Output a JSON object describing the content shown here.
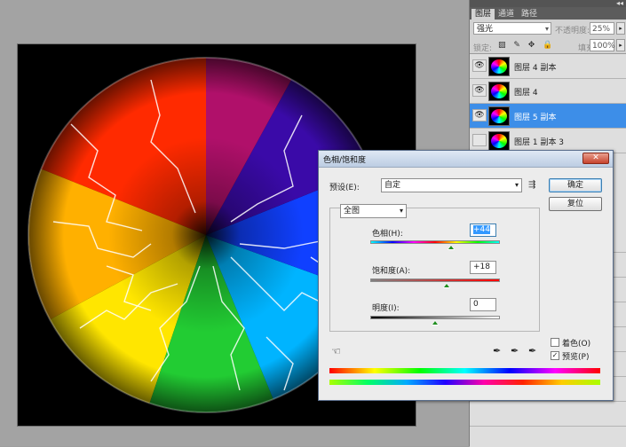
{
  "layers_panel": {
    "tabs": [
      "图层",
      "通道",
      "路径"
    ],
    "blend_mode": "强光",
    "opacity_label": "不透明度:",
    "opacity_value": "25%",
    "lock_label": "锁定:",
    "lock_icons": "▨ ✎ ✥ 🔒",
    "fill_label": "填充:",
    "fill_value": "100%",
    "layers": [
      {
        "name": "图层 4 副本",
        "visible": true,
        "selected": false
      },
      {
        "name": "图层 4",
        "visible": true,
        "selected": false
      },
      {
        "name": "图层 5 副本",
        "visible": true,
        "selected": true
      },
      {
        "name": "图层 1 副本 3",
        "visible": false,
        "selected": false
      }
    ],
    "eye_glyph": "👁"
  },
  "dialog": {
    "title": "色相/饱和度",
    "close_glyph": "✕",
    "preset_label": "预设(E):",
    "preset_value": "自定",
    "preset_menu_glyph": "⇶",
    "ok_label": "确定",
    "reset_label": "复位",
    "channel_value": "全图",
    "sliders": {
      "hue": {
        "label": "色相(H):",
        "value": "+44",
        "level": 44,
        "min": -180,
        "max": 180
      },
      "saturation": {
        "label": "饱和度(A):",
        "value": "+18",
        "level": 18,
        "min": -100,
        "max": 100
      },
      "lightness": {
        "label": "明度(I):",
        "value": "0",
        "level": 0,
        "min": -100,
        "max": 100
      }
    },
    "colorize_label": "着色(O)",
    "preview_label": "预览(P)",
    "colorize_checked": false,
    "preview_checked": true,
    "hand_icon": "☜",
    "eyedroppers": [
      "✒",
      "✒",
      "✒"
    ]
  },
  "colors": {
    "selection": "#3d8ee8",
    "dialog_bg": "#ececec",
    "canvas_bg": "#000000"
  }
}
